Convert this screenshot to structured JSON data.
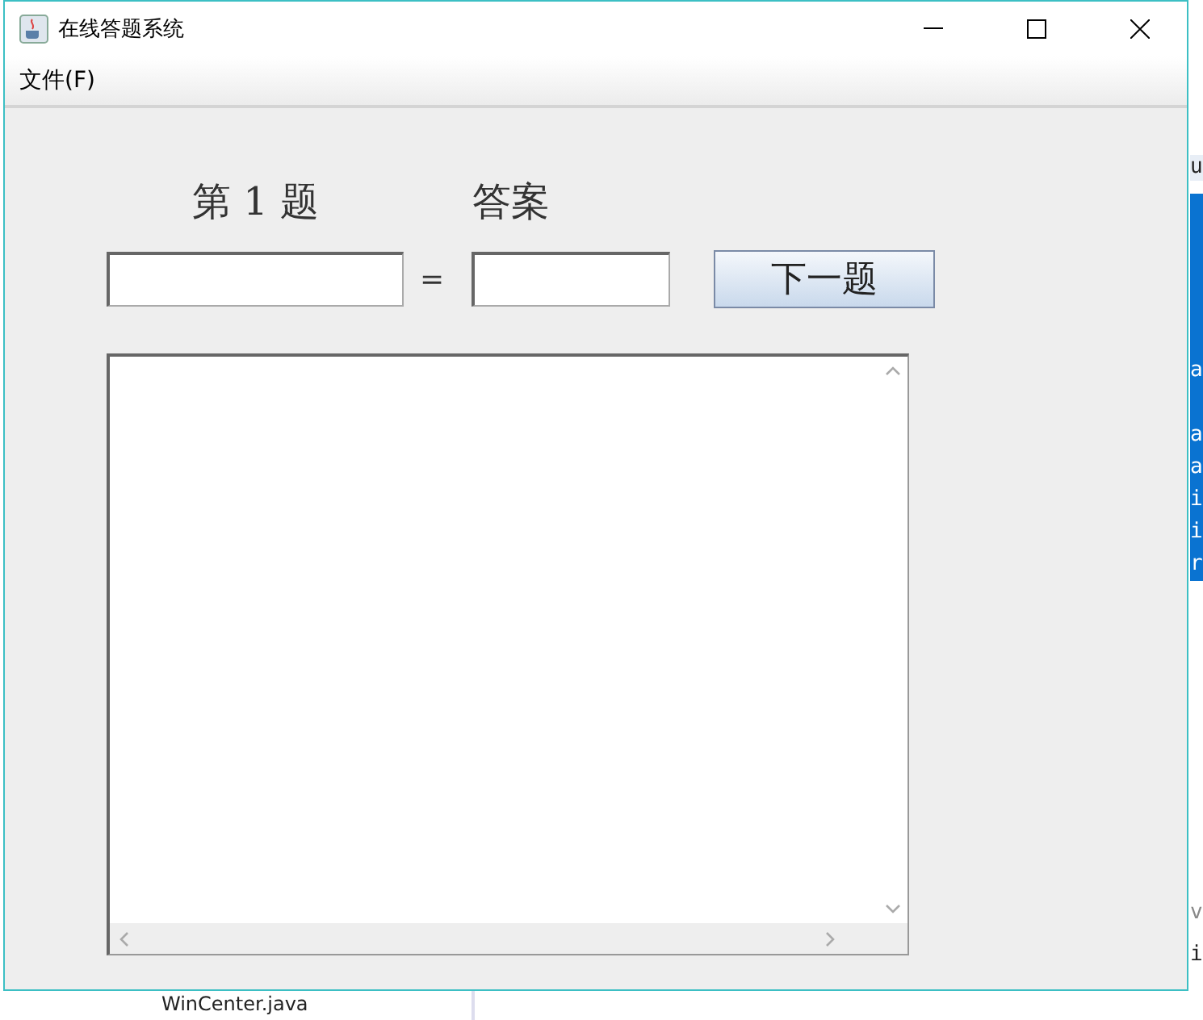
{
  "window": {
    "title": "在线答题系统"
  },
  "menu": [
    {
      "label": "文件(F)"
    }
  ],
  "quiz": {
    "question_label": "第 1 题",
    "answer_label": "答案",
    "equals": "=",
    "next_button": "下一题"
  },
  "background": {
    "file_tree_item": "WinCenter.java",
    "editor_lines": [
      "u",
      "a",
      "a",
      "a",
      "i",
      "i",
      "r"
    ],
    "panel_lines": [
      "v",
      "i"
    ]
  }
}
